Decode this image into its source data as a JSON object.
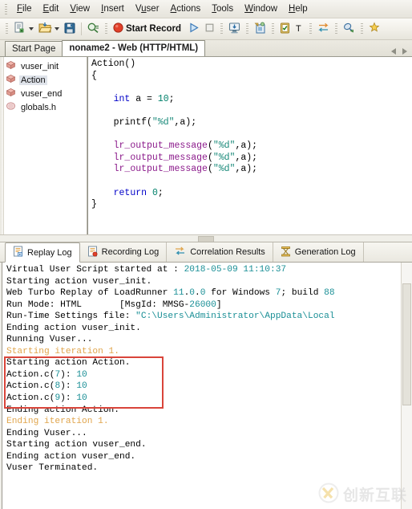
{
  "menubar": {
    "items": [
      {
        "label": "File",
        "accel": "F"
      },
      {
        "label": "Edit",
        "accel": "E"
      },
      {
        "label": "View",
        "accel": "V"
      },
      {
        "label": "Insert",
        "accel": "I"
      },
      {
        "label": "Vuser",
        "accel": "u"
      },
      {
        "label": "Actions",
        "accel": "A"
      },
      {
        "label": "Tools",
        "accel": "T"
      },
      {
        "label": "Window",
        "accel": "W"
      },
      {
        "label": "Help",
        "accel": "H"
      }
    ]
  },
  "toolbar": {
    "new_script_icon": "new-script-icon",
    "open_script_icon": "open-folder-icon",
    "save_icon": "save-disk-icon",
    "find_icon": "find-magnifier-icon",
    "record_label": "Start Record",
    "record_icon": "record-circle-icon",
    "run_icon": "run-play-icon",
    "stop_icon": "stop-square-icon",
    "compile_icon": "compile-icon",
    "run_step_icon": "run-step-icon",
    "tasks_icon": "tasks-clipboard-icon",
    "text_icon": "text-T-icon",
    "correlate_icon": "correlate-arrows-icon",
    "param_icon": "parameter-icon",
    "snapshot_icon": "snapshot-star-icon"
  },
  "tabs": {
    "items": [
      {
        "label": "Start Page",
        "active": false
      },
      {
        "label": "noname2 - Web (HTTP/HTML)",
        "active": true
      }
    ],
    "nav_prev_icon": "nav-prev-icon",
    "nav_next_icon": "nav-next-icon"
  },
  "tree": {
    "items": [
      {
        "label": "vuser_init",
        "icon": "action-block-icon",
        "selected": false
      },
      {
        "label": "Action",
        "icon": "action-block-icon",
        "selected": true
      },
      {
        "label": "vuser_end",
        "icon": "action-block-icon",
        "selected": false
      },
      {
        "label": "globals.h",
        "icon": "header-file-icon",
        "selected": false
      }
    ]
  },
  "editor": {
    "lines": [
      [
        {
          "t": "Action()",
          "c": "plain"
        }
      ],
      [
        {
          "t": "{",
          "c": "plain"
        }
      ],
      [
        {
          "t": "",
          "c": "plain"
        }
      ],
      [
        {
          "t": "    ",
          "c": "plain"
        },
        {
          "t": "int",
          "c": "k"
        },
        {
          "t": " a = ",
          "c": "plain"
        },
        {
          "t": "10",
          "c": "num"
        },
        {
          "t": ";",
          "c": "plain"
        }
      ],
      [
        {
          "t": "",
          "c": "plain"
        }
      ],
      [
        {
          "t": "    printf(",
          "c": "plain"
        },
        {
          "t": "\"%d\"",
          "c": "str"
        },
        {
          "t": ",a);",
          "c": "plain"
        }
      ],
      [
        {
          "t": "",
          "c": "plain"
        }
      ],
      [
        {
          "t": "    ",
          "c": "plain"
        },
        {
          "t": "lr_output_message",
          "c": "fn"
        },
        {
          "t": "(",
          "c": "plain"
        },
        {
          "t": "\"%d\"",
          "c": "str"
        },
        {
          "t": ",a);",
          "c": "plain"
        }
      ],
      [
        {
          "t": "    ",
          "c": "plain"
        },
        {
          "t": "lr_output_message",
          "c": "fn"
        },
        {
          "t": "(",
          "c": "plain"
        },
        {
          "t": "\"%d\"",
          "c": "str"
        },
        {
          "t": ",a);",
          "c": "plain"
        }
      ],
      [
        {
          "t": "    ",
          "c": "plain"
        },
        {
          "t": "lr_output_message",
          "c": "fn"
        },
        {
          "t": "(",
          "c": "plain"
        },
        {
          "t": "\"%d\"",
          "c": "str"
        },
        {
          "t": ",a);",
          "c": "plain"
        }
      ],
      [
        {
          "t": "",
          "c": "plain"
        }
      ],
      [
        {
          "t": "    ",
          "c": "plain"
        },
        {
          "t": "return",
          "c": "rw"
        },
        {
          "t": " ",
          "c": "plain"
        },
        {
          "t": "0",
          "c": "num"
        },
        {
          "t": ";",
          "c": "plain"
        }
      ],
      [
        {
          "t": "}",
          "c": "plain"
        }
      ]
    ]
  },
  "logtabs": {
    "items": [
      {
        "label": "Replay Log",
        "icon": "replay-log-icon",
        "active": true
      },
      {
        "label": "Recording Log",
        "icon": "recording-log-icon",
        "active": false
      },
      {
        "label": "Correlation Results",
        "icon": "correlation-results-icon",
        "active": false
      },
      {
        "label": "Generation Log",
        "icon": "generation-log-icon",
        "active": false
      }
    ]
  },
  "log": {
    "lines": [
      [
        {
          "t": "Virtual User Script started at : ",
          "c": "plain"
        },
        {
          "t": "2018-05-09 11:10:37",
          "c": "cy"
        }
      ],
      [
        {
          "t": "Starting action vuser_init.",
          "c": "plain"
        }
      ],
      [
        {
          "t": "Web Turbo Replay of LoadRunner ",
          "c": "plain"
        },
        {
          "t": "11",
          "c": "cy"
        },
        {
          "t": ".",
          "c": "plain"
        },
        {
          "t": "0",
          "c": "cy"
        },
        {
          "t": ".",
          "c": "plain"
        },
        {
          "t": "0",
          "c": "cy"
        },
        {
          "t": " for Windows ",
          "c": "plain"
        },
        {
          "t": "7",
          "c": "cy"
        },
        {
          "t": "; build ",
          "c": "plain"
        },
        {
          "t": "88",
          "c": "cy"
        }
      ],
      [
        {
          "t": "Run Mode: HTML       [MsgId: MMSG-",
          "c": "plain"
        },
        {
          "t": "26000",
          "c": "cy"
        },
        {
          "t": "]",
          "c": "plain"
        }
      ],
      [
        {
          "t": "Run-Time Settings file: ",
          "c": "plain"
        },
        {
          "t": "\"C:\\Users\\Administrator\\AppData\\Local",
          "c": "cy"
        }
      ],
      [
        {
          "t": "Ending action vuser_init.",
          "c": "plain"
        }
      ],
      [
        {
          "t": "Running Vuser...",
          "c": "plain"
        }
      ],
      [
        {
          "t": "Starting iteration 1.",
          "c": "or"
        }
      ],
      [
        {
          "t": "Starting action Action.",
          "c": "plain"
        }
      ],
      [
        {
          "t": "Action.c(",
          "c": "plain"
        },
        {
          "t": "7",
          "c": "cy"
        },
        {
          "t": "): ",
          "c": "plain"
        },
        {
          "t": "10",
          "c": "cy"
        }
      ],
      [
        {
          "t": "Action.c(",
          "c": "plain"
        },
        {
          "t": "8",
          "c": "cy"
        },
        {
          "t": "): ",
          "c": "plain"
        },
        {
          "t": "10",
          "c": "cy"
        }
      ],
      [
        {
          "t": "Action.c(",
          "c": "plain"
        },
        {
          "t": "9",
          "c": "cy"
        },
        {
          "t": "): ",
          "c": "plain"
        },
        {
          "t": "10",
          "c": "cy"
        }
      ],
      [
        {
          "t": "Ending action Action.",
          "c": "plain"
        }
      ],
      [
        {
          "t": "Ending iteration 1.",
          "c": "or"
        }
      ],
      [
        {
          "t": "Ending Vuser...",
          "c": "plain"
        }
      ],
      [
        {
          "t": "Starting action vuser_end.",
          "c": "plain"
        }
      ],
      [
        {
          "t": "Ending action vuser_end.",
          "c": "plain"
        }
      ],
      [
        {
          "t": "Vuser Terminated.",
          "c": "plain"
        }
      ]
    ],
    "highlight_box": {
      "color": "#d9453a",
      "first_line": 8,
      "last_line": 11
    }
  },
  "watermark": {
    "text": "创新互联",
    "logo_icon": "x-logo-icon"
  },
  "colors": {
    "accent_red": "#d9453a",
    "keyword_blue": "#0000c8",
    "string_teal": "#1a8a7a",
    "function_purple": "#8b1a8b",
    "log_cyan": "#1a8f96",
    "log_orange": "#e0a54c"
  }
}
